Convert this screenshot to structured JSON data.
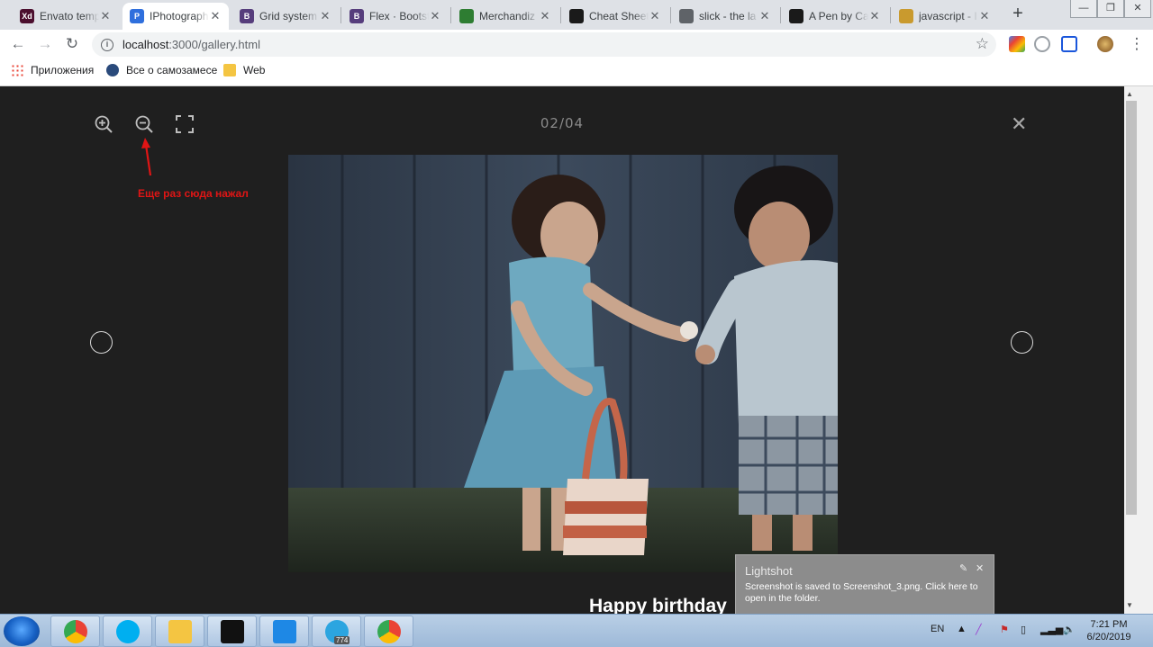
{
  "tabs": [
    {
      "title": "Envato temp",
      "color": "#4c0f2e",
      "glyph": "Xd",
      "active": false
    },
    {
      "title": "IPhotograph",
      "color": "#2f6fdd",
      "glyph": "P",
      "active": true
    },
    {
      "title": "Grid system",
      "color": "#563d7c",
      "glyph": "B",
      "active": false
    },
    {
      "title": "Flex · Bootst",
      "color": "#563d7c",
      "glyph": "B",
      "active": false
    },
    {
      "title": "Merchandiz",
      "color": "#2e7d32",
      "glyph": "",
      "active": false
    },
    {
      "title": "Cheat Sheet",
      "color": "#1a1a1a",
      "glyph": "",
      "active": false
    },
    {
      "title": "slick - the la",
      "color": "#5f6368",
      "glyph": "",
      "active": false
    },
    {
      "title": "A Pen by Ca",
      "color": "#1a1a1a",
      "glyph": "",
      "active": false
    },
    {
      "title": "javascript - I",
      "color": "#c99a2e",
      "glyph": "",
      "active": false
    }
  ],
  "omnibox": {
    "host": "localhost",
    "path": ":3000/gallery.html"
  },
  "bookmarks": [
    {
      "label": "Приложения",
      "color": "#4285f4"
    },
    {
      "label": "Все о самозамесе",
      "color": "#2a4a7b"
    },
    {
      "label": "Web",
      "color": "#f4c542"
    }
  ],
  "gallery": {
    "counter": "02/04",
    "close_glyph": "✕",
    "caption": "Happy birthday",
    "annotation": "Еще раз сюда нажал"
  },
  "toast": {
    "title": "Lightshot",
    "message": "Screenshot is saved to Screenshot_3.png. Click here to open in the folder."
  },
  "taskbar": {
    "apps": [
      "chrome",
      "skype",
      "explorer",
      "cmd",
      "vscode",
      "telegram",
      "chrome"
    ],
    "telegram_badge": "774",
    "lang": "EN",
    "time": "7:21 PM",
    "date": "6/20/2019"
  },
  "colors": {
    "accent_red": "#e01515",
    "viewer_bg": "#1f1f1f"
  }
}
